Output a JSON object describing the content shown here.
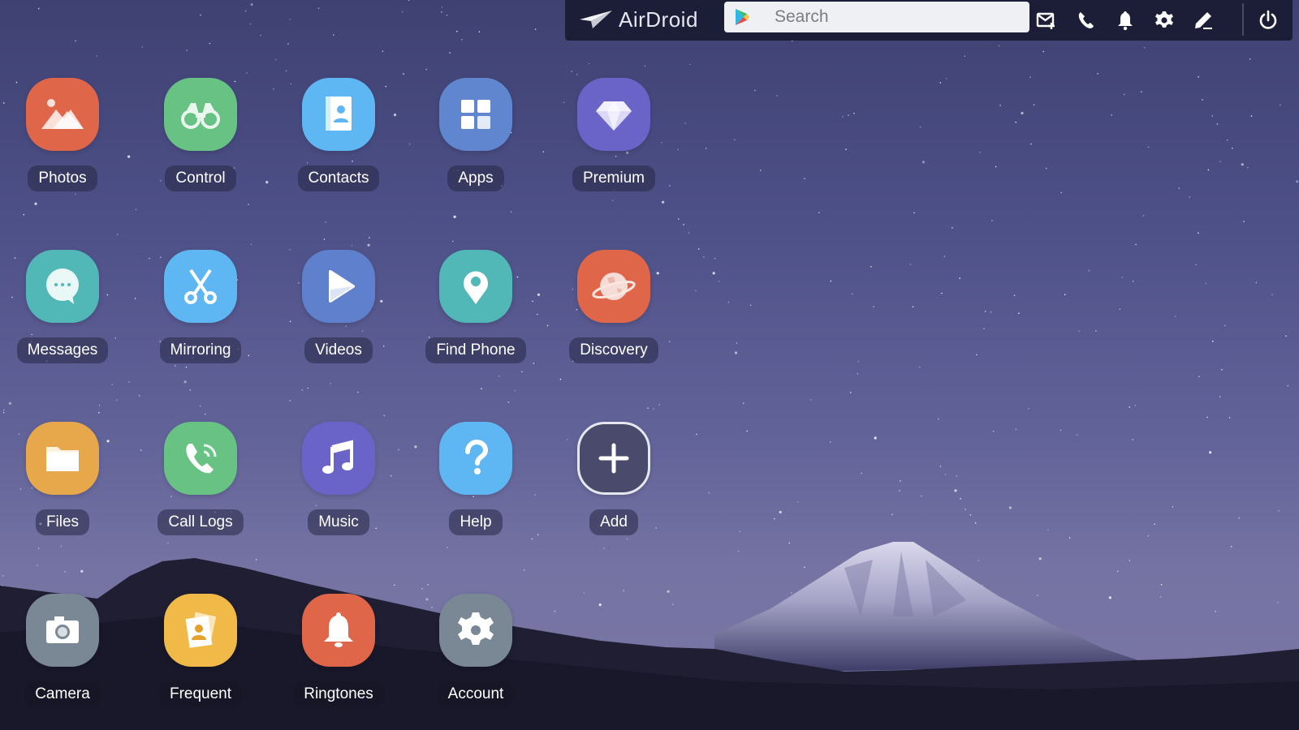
{
  "toolbar": {
    "brand": "AirDroid",
    "search_placeholder": "Search",
    "icons": [
      {
        "name": "new-message-icon",
        "label": "New message"
      },
      {
        "name": "phone-icon",
        "label": "Call"
      },
      {
        "name": "bell-icon",
        "label": "Notifications"
      },
      {
        "name": "gear-icon",
        "label": "Settings"
      },
      {
        "name": "pencil-icon",
        "label": "Edit"
      },
      {
        "name": "power-icon",
        "label": "Log out"
      }
    ]
  },
  "apps": [
    {
      "label": "Photos",
      "icon": "photos-icon",
      "color": "#e0664a"
    },
    {
      "label": "Control",
      "icon": "binoculars-icon",
      "color": "#67c283"
    },
    {
      "label": "Contacts",
      "icon": "contacts-book-icon",
      "color": "#5eb6f2"
    },
    {
      "label": "Apps",
      "icon": "apps-grid-icon",
      "color": "#5f86cf"
    },
    {
      "label": "Premium",
      "icon": "diamond-icon",
      "color": "#6a63c8"
    },
    {
      "label": "Messages",
      "icon": "chat-bubble-icon",
      "color": "#52b7b7"
    },
    {
      "label": "Mirroring",
      "icon": "scissors-icon",
      "color": "#5eb6f2"
    },
    {
      "label": "Videos",
      "icon": "play-icon",
      "color": "#5f80cc"
    },
    {
      "label": "Find Phone",
      "icon": "location-pin-icon",
      "color": "#52b7b7"
    },
    {
      "label": "Discovery",
      "icon": "planet-icon",
      "color": "#e0664a"
    },
    {
      "label": "Files",
      "icon": "folder-icon",
      "color": "#e6a84a"
    },
    {
      "label": "Call Logs",
      "icon": "call-log-icon",
      "color": "#67c283"
    },
    {
      "label": "Music",
      "icon": "music-note-icon",
      "color": "#6a63c8"
    },
    {
      "label": "Help",
      "icon": "question-mark-icon",
      "color": "#5eb6f2"
    },
    {
      "label": "Add",
      "icon": "plus-icon",
      "color": "#4a4a6c"
    },
    {
      "label": "Camera",
      "icon": "camera-icon",
      "color": "#7a8896"
    },
    {
      "label": "Frequent",
      "icon": "frequent-contacts-icon",
      "color": "#f0b948"
    },
    {
      "label": "Ringtones",
      "icon": "bell-ringtone-icon",
      "color": "#e0664a"
    },
    {
      "label": "Account",
      "icon": "account-gear-icon",
      "color": "#7a8896"
    }
  ]
}
